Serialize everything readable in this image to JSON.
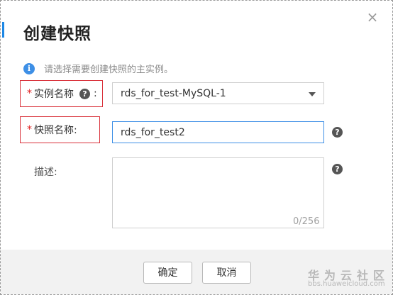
{
  "dialog": {
    "title": "创建快照",
    "close_icon": "close-icon"
  },
  "info": {
    "icon": "info-icon",
    "text": "请选择需要创建快照的主实例。"
  },
  "form": {
    "instance": {
      "required_mark": "*",
      "label": "实例名称",
      "colon": ":",
      "help_icon": "question-circle-icon",
      "selected_value": "rds_for_test-MySQL-1"
    },
    "snapshot": {
      "required_mark": "*",
      "label": "快照名称:",
      "value": "rds_for_test2",
      "help_icon": "question-circle-icon"
    },
    "description": {
      "label": "描述:",
      "value": "",
      "counter": "0/256",
      "help_icon": "question-circle-icon"
    }
  },
  "footer": {
    "confirm_label": "确定",
    "cancel_label": "取消"
  },
  "watermark": {
    "brand": "华为云社区",
    "url": "bbs.huaweicloud.com"
  },
  "colors": {
    "accent": "#1e88e5",
    "required": "#e02020",
    "highlight_border": "#d9313a",
    "focus_border": "#3d8fe6"
  }
}
